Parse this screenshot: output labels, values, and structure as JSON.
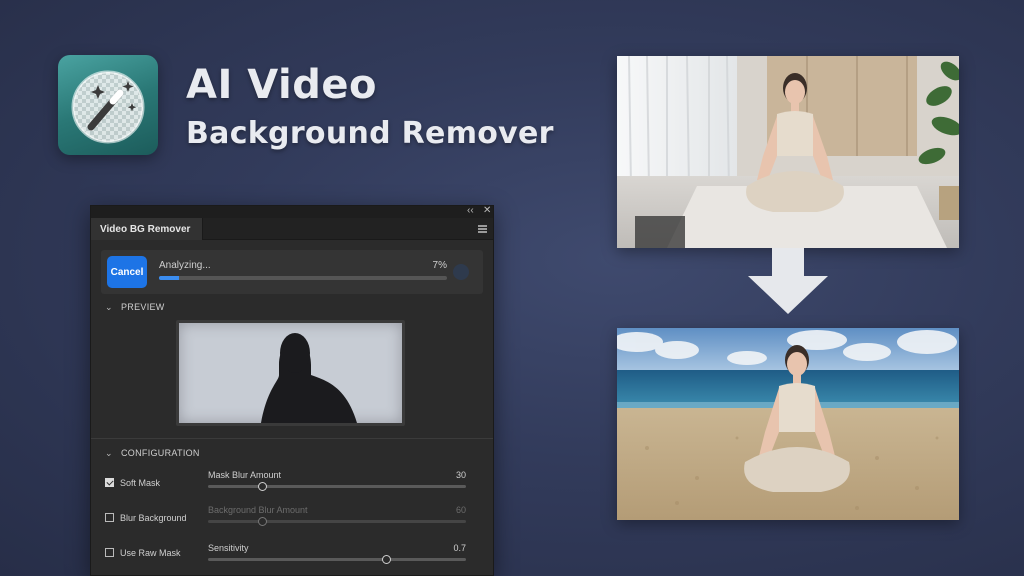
{
  "hero": {
    "title": "AI Video",
    "subtitle": "Background Remover",
    "logo_icon": "magic-wand-icon",
    "accent_color": "#2a7876"
  },
  "panel": {
    "tab_title": "Video BG Remover",
    "collapse_glyph": "‹‹",
    "close_glyph": "✕",
    "progress": {
      "cancel_label": "Cancel",
      "status": "Analyzing...",
      "percent_text": "7%",
      "fraction": 0.07,
      "accent_color": "#1d74e6"
    },
    "preview": {
      "heading": "PREVIEW"
    },
    "configuration": {
      "heading": "CONFIGURATION",
      "options": [
        {
          "label": "Soft Mask",
          "checked": true
        },
        {
          "label": "Blur Background",
          "checked": false
        },
        {
          "label": "Use Raw Mask",
          "checked": false
        }
      ],
      "sliders": [
        {
          "label": "Mask Blur Amount",
          "value": "30",
          "fraction": 0.21,
          "disabled": false
        },
        {
          "label": "Background Blur Amount",
          "value": "60",
          "fraction": 0.21,
          "disabled": true
        },
        {
          "label": "Sensitivity",
          "value": "0.7",
          "fraction": 0.69,
          "disabled": false
        }
      ]
    }
  },
  "images": {
    "before": "original-yoga-room-photo",
    "after": "beach-background-composite",
    "arrow_icon": "arrow-down-icon"
  }
}
